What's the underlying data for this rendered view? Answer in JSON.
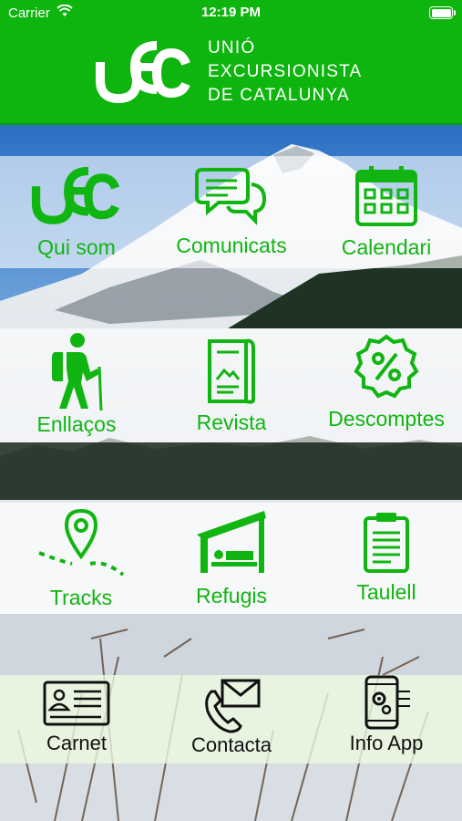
{
  "status_bar": {
    "carrier": "Carrier",
    "time": "12:19 PM"
  },
  "header": {
    "org_lines": [
      "UNIÓ",
      "EXCURSIONISTA",
      "DE CATALUNYA"
    ],
    "brand_color": "#0fb50f"
  },
  "menu": {
    "row1": [
      {
        "label": "Qui som",
        "icon": "uec-logo-icon"
      },
      {
        "label": "Comunicats",
        "icon": "chat-bubbles-icon"
      },
      {
        "label": "Calendari",
        "icon": "calendar-icon"
      }
    ],
    "row2": [
      {
        "label": "Enllaços",
        "icon": "hiker-icon"
      },
      {
        "label": "Revista",
        "icon": "magazine-icon"
      },
      {
        "label": "Descomptes",
        "icon": "discount-badge-icon"
      }
    ],
    "row3": [
      {
        "label": "Tracks",
        "icon": "map-pin-route-icon"
      },
      {
        "label": "Refugis",
        "icon": "shelter-bed-icon"
      },
      {
        "label": "Taulell",
        "icon": "clipboard-icon"
      }
    ],
    "row4": [
      {
        "label": "Carnet",
        "icon": "id-card-icon"
      },
      {
        "label": "Contacta",
        "icon": "phone-envelope-icon"
      },
      {
        "label": "Info App",
        "icon": "phone-gear-icon"
      }
    ]
  },
  "colors": {
    "accent": "#11b511",
    "text_dark": "#111111"
  }
}
